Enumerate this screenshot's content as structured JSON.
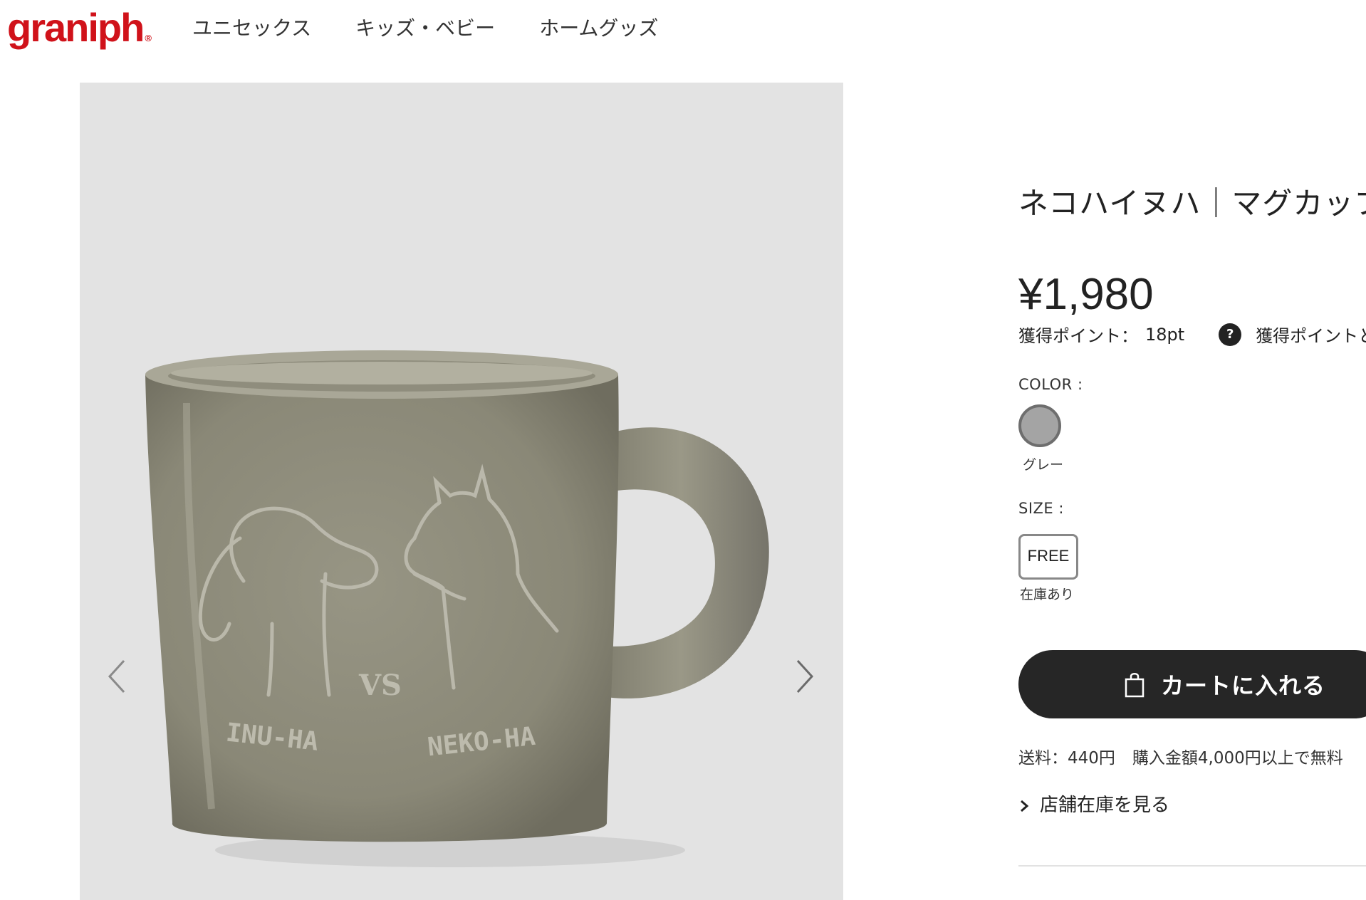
{
  "header": {
    "logo": "graniph",
    "logo_mark": "®",
    "nav": [
      {
        "label": "ユニセックス"
      },
      {
        "label": "キッズ・ベビー"
      },
      {
        "label": "ホームグッズ"
      }
    ]
  },
  "gallery": {
    "image_subject": "mug",
    "left_icon": "chevron-left-icon",
    "right_icon": "chevron-right-icon",
    "embossed_text": {
      "left": "INU-HA",
      "middle": "VS",
      "right": "NEKO-HA"
    }
  },
  "product": {
    "title": "ネコハイヌハ｜マグカップ",
    "price": "¥1,980",
    "points_label": "獲得ポイント：",
    "points_value": "18pt",
    "points_help_icon": "question-icon",
    "points_help_label": "獲得ポイントとは",
    "color_label": "COLOR :",
    "color_name": "グレー",
    "color_swatch": "#a4a4a4",
    "size_label": "SIZE :",
    "size_value": "FREE",
    "stock_status": "在庫あり",
    "cart_label": "カートに入れる",
    "cart_icon": "shopping-bag-icon",
    "shipping_fee": "送料：440円",
    "shipping_free": "購入金額4,000円以上で無料",
    "store_stock_link": "店舗在庫を見る"
  },
  "colors": {
    "brand": "#d0121a",
    "button": "#262626",
    "gallery_bg": "#e3e3e3",
    "mug": "#8c8a7a"
  }
}
